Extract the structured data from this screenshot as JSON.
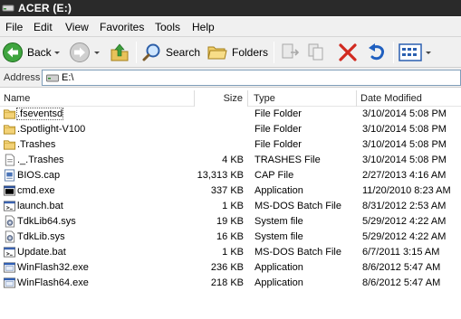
{
  "window": {
    "title": "ACER (E:)"
  },
  "menu": [
    "File",
    "Edit",
    "View",
    "Favorites",
    "Tools",
    "Help"
  ],
  "toolbar": {
    "back_label": "Back",
    "search_label": "Search",
    "folders_label": "Folders"
  },
  "address": {
    "label": "Address",
    "value": "E:\\"
  },
  "columns": {
    "name": "Name",
    "size": "Size",
    "type": "Type",
    "date": "Date Modified"
  },
  "files": [
    {
      "name": ".fseventsd",
      "size": "",
      "type": "File Folder",
      "date": "3/10/2014 5:08 PM",
      "icon": "folder-icon"
    },
    {
      "name": ".Spotlight-V100",
      "size": "",
      "type": "File Folder",
      "date": "3/10/2014 5:08 PM",
      "icon": "folder-icon"
    },
    {
      "name": ".Trashes",
      "size": "",
      "type": "File Folder",
      "date": "3/10/2014 5:08 PM",
      "icon": "folder-icon"
    },
    {
      "name": "._.Trashes",
      "size": "4 KB",
      "type": "TRASHES File",
      "date": "3/10/2014 5:08 PM",
      "icon": "document-icon"
    },
    {
      "name": "BIOS.cap",
      "size": "13,313 KB",
      "type": "CAP File",
      "date": "2/27/2013 4:16 AM",
      "icon": "binary-file-icon"
    },
    {
      "name": "cmd.exe",
      "size": "337 KB",
      "type": "Application",
      "date": "11/20/2010 8:23 AM",
      "icon": "console-icon"
    },
    {
      "name": "launch.bat",
      "size": "1 KB",
      "type": "MS-DOS Batch File",
      "date": "8/31/2012 2:53 AM",
      "icon": "batch-file-icon"
    },
    {
      "name": "TdkLib64.sys",
      "size": "19 KB",
      "type": "System file",
      "date": "5/29/2012 4:22 AM",
      "icon": "system-file-icon"
    },
    {
      "name": "TdkLib.sys",
      "size": "16 KB",
      "type": "System file",
      "date": "5/29/2012 4:22 AM",
      "icon": "system-file-icon"
    },
    {
      "name": "Update.bat",
      "size": "1 KB",
      "type": "MS-DOS Batch File",
      "date": "6/7/2011 3:15 AM",
      "icon": "batch-file-icon"
    },
    {
      "name": "WinFlash32.exe",
      "size": "236 KB",
      "type": "Application",
      "date": "8/6/2012 5:47 AM",
      "icon": "application-icon"
    },
    {
      "name": "WinFlash64.exe",
      "size": "218 KB",
      "type": "Application",
      "date": "8/6/2012 5:47 AM",
      "icon": "application-icon"
    }
  ]
}
